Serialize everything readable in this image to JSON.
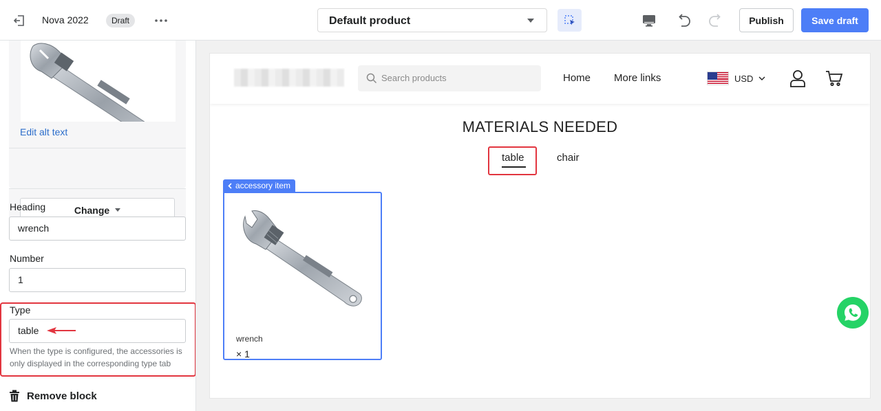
{
  "topbar": {
    "theme_name": "Nova 2022",
    "badge": "Draft",
    "template_select": "Default product",
    "publish_label": "Publish",
    "save_label": "Save draft"
  },
  "sidebar": {
    "edit_alt_text": "Edit alt text",
    "change_label": "Change",
    "heading_label": "Heading",
    "heading_value": "wrench",
    "number_label": "Number",
    "number_value": "1",
    "type_label": "Type",
    "type_value": "table",
    "type_help": "When the type is configured, the accessories is only displayed in the corresponding type tab",
    "remove_block": "Remove block"
  },
  "preview": {
    "search_placeholder": "Search products",
    "nav": [
      "Home",
      "More links"
    ],
    "currency": "USD",
    "section_title": "MATERIALS NEEDED",
    "tabs": [
      "table",
      "chair"
    ],
    "accessory_tag": "accessory item",
    "product_name": "wrench",
    "product_qty": "× 1"
  },
  "colors": {
    "accent": "#4d7ef7",
    "highlight_red": "#e2353f",
    "whatsapp": "#25d366"
  },
  "icons": [
    "exit-icon",
    "more-dots-icon",
    "chevron-down-icon",
    "inspector-icon",
    "desktop-icon",
    "undo-icon",
    "redo-icon",
    "trash-icon",
    "search-icon",
    "chevron-down-icon",
    "user-icon",
    "cart-icon",
    "chevron-left-icon",
    "whatsapp-icon",
    "arrow-left-icon"
  ]
}
